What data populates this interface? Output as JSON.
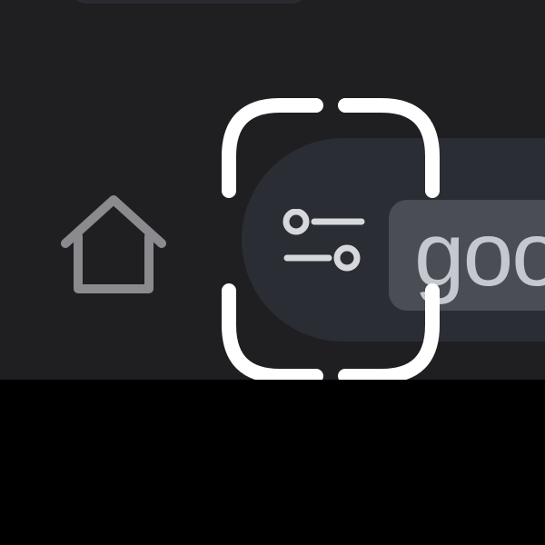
{
  "toolbar": {
    "home_button": {
      "icon": "home-icon"
    },
    "site_settings_button": {
      "icon": "tune-icon"
    },
    "address_bar": {
      "visible_text": "goo"
    }
  },
  "colors": {
    "toolbar_background": "#1f1f22",
    "page_background": "#000000",
    "button_background": "#2a2d33",
    "url_chip_background": "#4a4d54",
    "icon_muted": "#8a8a8f",
    "icon_light": "#d7d8dc",
    "focus_ring": "#ffffff",
    "url_text": "#c5c8cf"
  }
}
